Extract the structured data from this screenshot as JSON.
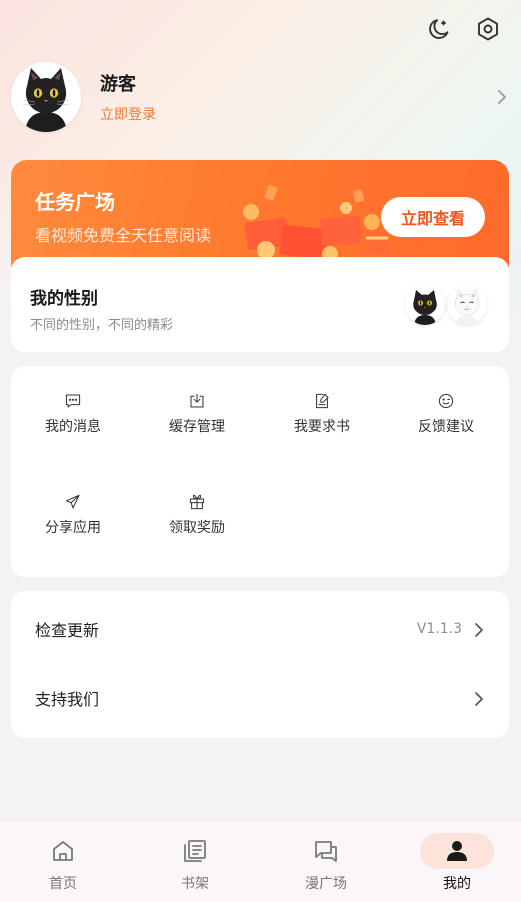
{
  "header": {
    "night_mode_icon": "moon-icon",
    "settings_icon": "hexagon-settings-icon"
  },
  "profile": {
    "username": "游客",
    "login_link": "立即登录"
  },
  "task_banner": {
    "title": "任务广场",
    "subtitle": "看视频免费全天任意阅读",
    "button": "立即查看",
    "accent": "#ff7a2e"
  },
  "gender": {
    "title": "我的性别",
    "subtitle": "不同的性别，不同的精彩"
  },
  "menu": {
    "items": [
      {
        "label": "我的消息",
        "icon": "message-icon"
      },
      {
        "label": "缓存管理",
        "icon": "download-icon"
      },
      {
        "label": "我要求书",
        "icon": "edit-document-icon"
      },
      {
        "label": "反馈建议",
        "icon": "wink-face-icon"
      },
      {
        "label": "分享应用",
        "icon": "paper-plane-icon"
      },
      {
        "label": "领取奖励",
        "icon": "gift-icon"
      }
    ]
  },
  "settings_list": {
    "check_update": {
      "label": "检查更新",
      "value": "V1.1.3"
    },
    "support_us": {
      "label": "支持我们"
    }
  },
  "tabbar": {
    "tabs": [
      {
        "label": "首页",
        "icon": "home-icon"
      },
      {
        "label": "书架",
        "icon": "bookshelf-icon"
      },
      {
        "label": "漫广场",
        "icon": "chat-bubbles-icon"
      },
      {
        "label": "我的",
        "icon": "person-icon",
        "active": true
      }
    ],
    "active_color": "#fde3da"
  }
}
